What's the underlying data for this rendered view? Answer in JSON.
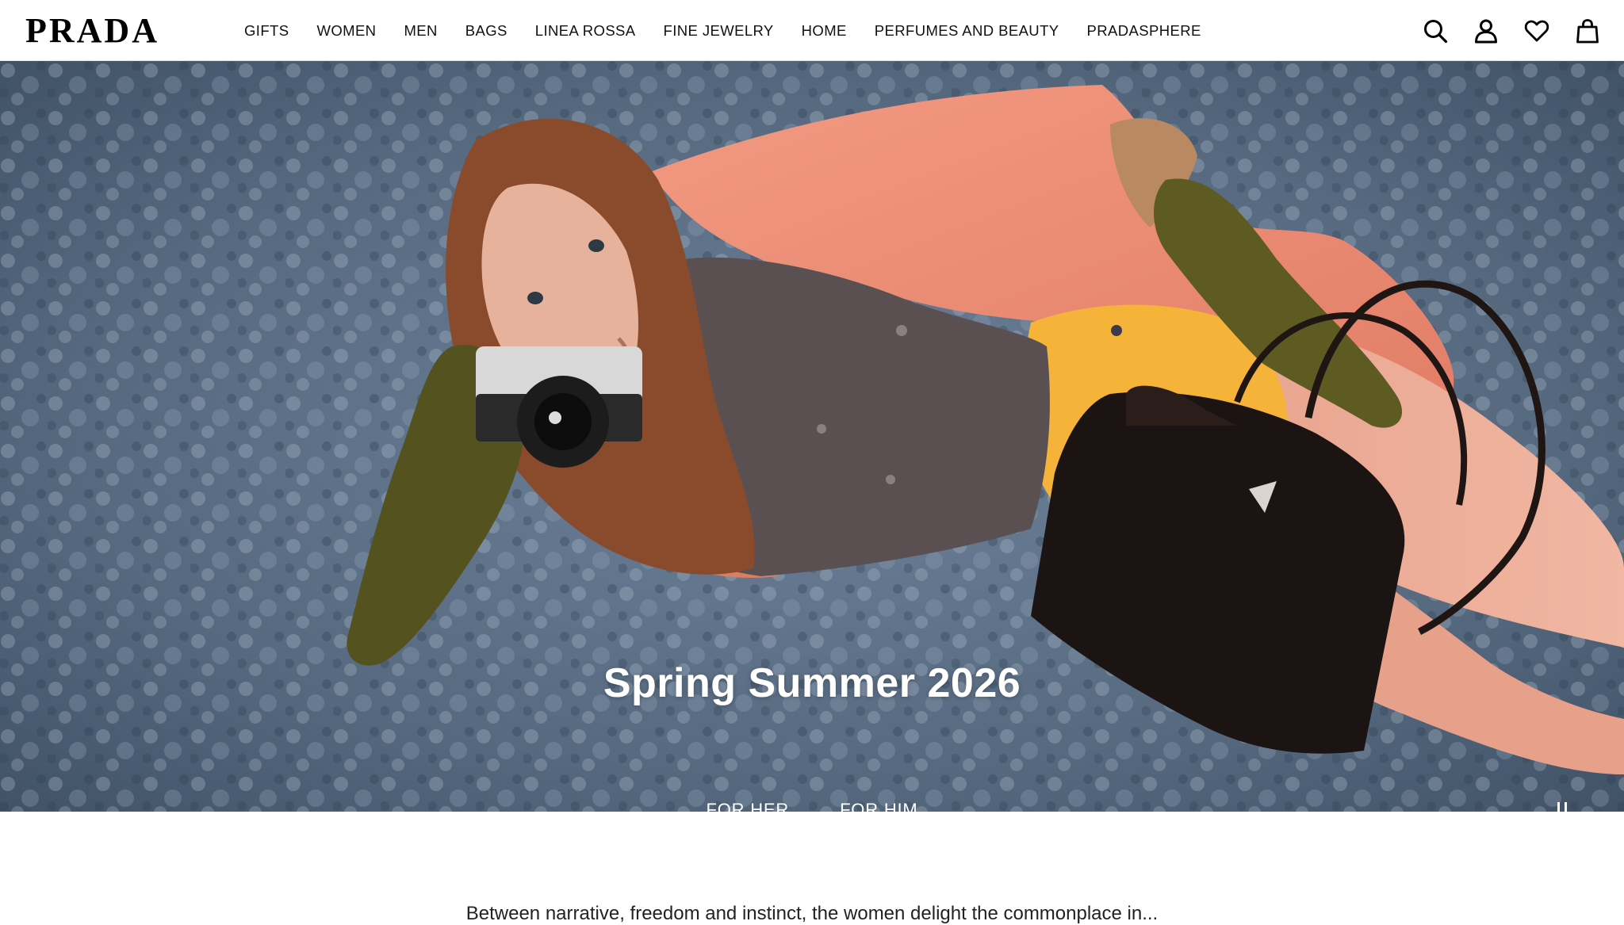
{
  "brand": {
    "logo": "PRADA"
  },
  "nav": {
    "items": [
      {
        "label": "GIFTS"
      },
      {
        "label": "WOMEN"
      },
      {
        "label": "MEN"
      },
      {
        "label": "BAGS"
      },
      {
        "label": "LINEA ROSSA"
      },
      {
        "label": "FINE JEWELRY"
      },
      {
        "label": "HOME"
      },
      {
        "label": "PERFUMES AND BEAUTY"
      },
      {
        "label": "PRADASPHERE"
      }
    ]
  },
  "header_icons": [
    "search-icon",
    "account-icon",
    "wishlist-heart-icon",
    "shopping-bag-icon"
  ],
  "hero": {
    "title": "Spring Summer 2026",
    "links": [
      {
        "label": "FOR HER"
      },
      {
        "label": "FOR HIM"
      }
    ],
    "pause_icon": "pause-icon"
  },
  "intro": {
    "text": "Between narrative, freedom and instinct, the women delight the commonplace in..."
  },
  "colors": {
    "header_bg": "#ffffff",
    "text": "#111111",
    "hero_text": "#ffffff"
  }
}
